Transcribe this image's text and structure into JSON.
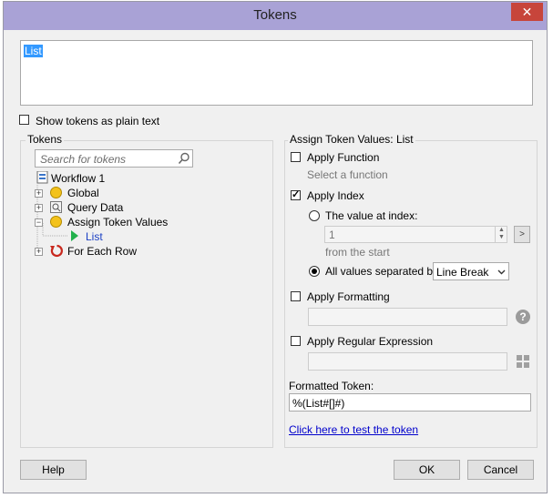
{
  "dialog": {
    "title": "Tokens",
    "close_glyph": "✕"
  },
  "token_text": "List",
  "plain_text_label": "Show tokens as plain text",
  "tokens_group": {
    "title": "Tokens",
    "search_placeholder": "Search for tokens",
    "tree": {
      "root": "Workflow 1",
      "global": "Global",
      "query_data": "Query Data",
      "assign": "Assign Token Values",
      "list": "List",
      "for_each": "For Each Row"
    }
  },
  "assign_group": {
    "title": "Assign Token Values: List",
    "apply_function": "Apply Function",
    "select_function": "Select a function",
    "apply_index": "Apply Index",
    "value_at_index": "The value at index:",
    "index_value": "1",
    "from_start": "from the  start",
    "all_values": "All values separated by:",
    "separator_value": "Line Break",
    "apply_formatting": "Apply Formatting",
    "apply_regex": "Apply Regular Expression",
    "formatted_token_label": "Formatted Token:",
    "formatted_token_value": "%(List#[]#)",
    "test_link": "Click here to test the token"
  },
  "buttons": {
    "help": "Help",
    "ok": "OK",
    "cancel": "Cancel"
  },
  "colors": {
    "titlebar": "#a9a2d6",
    "close": "#c7453b",
    "selection": "#3399ff",
    "link": "#0000cc"
  }
}
